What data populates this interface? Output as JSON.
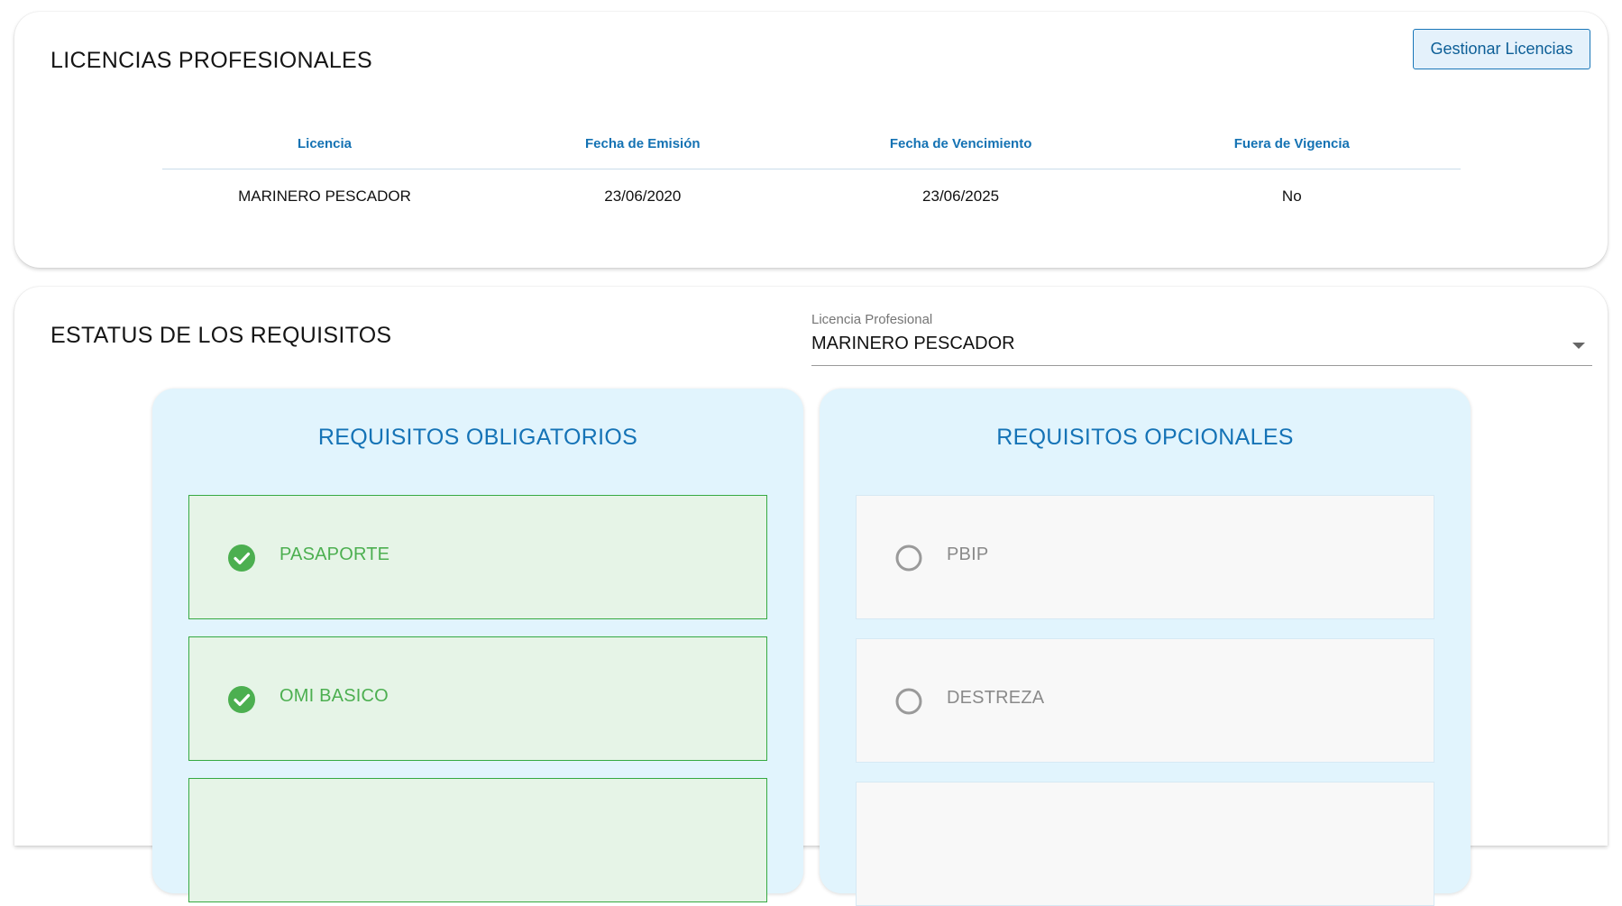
{
  "licencias": {
    "title": "LICENCIAS PROFESIONALES",
    "manage_button": "Gestionar Licencias",
    "columns": [
      "Licencia",
      "Fecha de Emisión",
      "Fecha de Vencimiento",
      "Fuera de Vigencia"
    ],
    "rows": [
      [
        "MARINERO PESCADOR",
        "23/06/2020",
        "23/06/2025",
        "No"
      ]
    ]
  },
  "estatus": {
    "title": "ESTATUS DE LOS REQUISITOS",
    "select": {
      "label": "Licencia Profesional",
      "value": "MARINERO PESCADOR"
    },
    "obligatorios": {
      "title": "REQUISITOS OBLIGATORIOS",
      "items": [
        {
          "label": "PASAPORTE",
          "status": "completed",
          "icon": "check-circle-icon"
        },
        {
          "label": "OMI BASICO",
          "status": "completed",
          "icon": "check-circle-icon"
        },
        {
          "label": "",
          "status": "completed",
          "icon": "check-circle-icon"
        }
      ]
    },
    "opcionales": {
      "title": "REQUISITOS OPCIONALES",
      "items": [
        {
          "label": "PBIP",
          "status": "pending",
          "icon": "empty-circle-icon"
        },
        {
          "label": "DESTREZA",
          "status": "pending",
          "icon": "empty-circle-icon"
        },
        {
          "label": "",
          "status": "pending",
          "icon": "empty-circle-icon"
        }
      ]
    }
  },
  "colors": {
    "accent": "#1573b6",
    "success": "#4caf50",
    "panel_bg": "#e1f4fd"
  }
}
